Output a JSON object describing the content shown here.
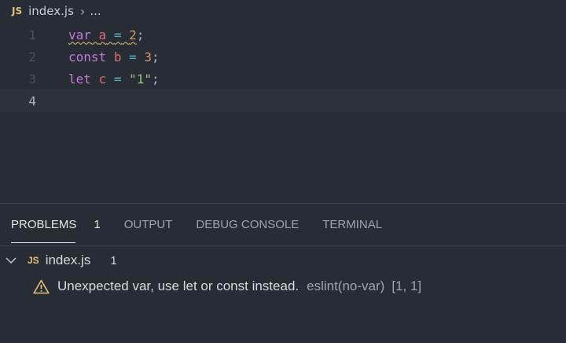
{
  "breadcrumb": {
    "lang_badge": "JS",
    "file": "index.js",
    "ellipsis": "..."
  },
  "editor": {
    "lines": [
      {
        "number": "1",
        "tokens": [
          {
            "t": "var",
            "c": "kw"
          },
          {
            "t": " "
          },
          {
            "t": "a",
            "c": "var"
          },
          {
            "t": " "
          },
          {
            "t": "=",
            "c": "op"
          },
          {
            "t": " "
          },
          {
            "t": "2",
            "c": "num"
          },
          {
            "t": ";",
            "c": "punc"
          }
        ]
      },
      {
        "number": "2",
        "tokens": [
          {
            "t": "const",
            "c": "kw"
          },
          {
            "t": " "
          },
          {
            "t": "b",
            "c": "var"
          },
          {
            "t": " "
          },
          {
            "t": "=",
            "c": "op"
          },
          {
            "t": " "
          },
          {
            "t": "3",
            "c": "num"
          },
          {
            "t": ";",
            "c": "punc"
          }
        ]
      },
      {
        "number": "3",
        "tokens": [
          {
            "t": "let",
            "c": "kw"
          },
          {
            "t": " "
          },
          {
            "t": "c",
            "c": "var"
          },
          {
            "t": " "
          },
          {
            "t": "=",
            "c": "op"
          },
          {
            "t": " "
          },
          {
            "t": "\"1\"",
            "c": "str"
          },
          {
            "t": ";",
            "c": "punc"
          }
        ]
      },
      {
        "number": "4",
        "tokens": []
      }
    ],
    "current_line": 4
  },
  "panel": {
    "tabs": [
      {
        "label": "PROBLEMS",
        "count": "1",
        "active": true
      },
      {
        "label": "OUTPUT"
      },
      {
        "label": "DEBUG CONSOLE"
      },
      {
        "label": "TERMINAL"
      }
    ],
    "file": {
      "lang_badge": "JS",
      "name": "index.js",
      "count": "1"
    },
    "problem": {
      "message": "Unexpected var, use let or const instead.",
      "source": "eslint(no-var)",
      "location": "[1, 1]"
    }
  },
  "colors": {
    "background": "#282c34",
    "keyword": "#c678dd",
    "variable": "#e06c75",
    "operator": "#56b6c2",
    "number": "#d19a66",
    "string": "#98c379",
    "warning": "#e5c07b"
  }
}
